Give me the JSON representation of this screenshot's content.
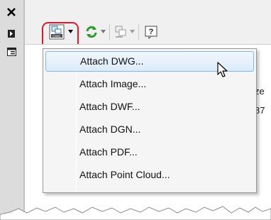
{
  "side_strip": {
    "icons": [
      "close-icon",
      "collapse-icon",
      "properties-icon"
    ]
  },
  "toolbar": {
    "buttons": [
      "attach-icon",
      "refresh-icon",
      "change-path-icon",
      "help-icon"
    ]
  },
  "menu": {
    "items": [
      {
        "label": "Attach DWG...",
        "active": true
      },
      {
        "label": "Attach Image..."
      },
      {
        "label": "Attach DWF..."
      },
      {
        "label": "Attach DGN..."
      },
      {
        "label": "Attach PDF..."
      },
      {
        "label": "Attach Point Cloud..."
      }
    ]
  },
  "list": {
    "column_header_partial": "ze",
    "row_partial": "87"
  },
  "colors": {
    "highlight_border": "#e0192a",
    "menu_hover_border": "#86b5e7"
  }
}
